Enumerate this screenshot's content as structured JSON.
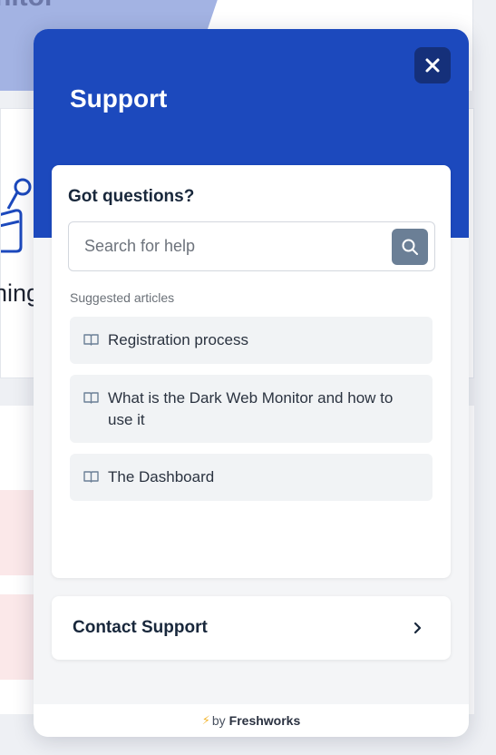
{
  "background": {
    "hero_title_fragment": "nitor",
    "card_title_fragment": "hing"
  },
  "widget": {
    "title": "Support",
    "close_icon": "close-icon",
    "questions": {
      "title": "Got questions?",
      "search_placeholder": "Search for help",
      "search_value": "",
      "section_label": "Suggested articles",
      "articles": [
        {
          "label": "Registration process",
          "icon": "book-icon"
        },
        {
          "label": "What is the Dark Web Monitor and how to use it",
          "icon": "book-icon"
        },
        {
          "label": "The Dashboard",
          "icon": "book-icon"
        }
      ]
    },
    "contact": {
      "label": "Contact Support",
      "icon": "chevron-right-icon"
    },
    "footer": {
      "prefix": "by",
      "brand": "Freshworks"
    }
  },
  "colors": {
    "header_blue": "#1c49bd",
    "close_button": "#15307a",
    "search_button": "#6b7f96",
    "article_bg": "#f1f3f5"
  }
}
